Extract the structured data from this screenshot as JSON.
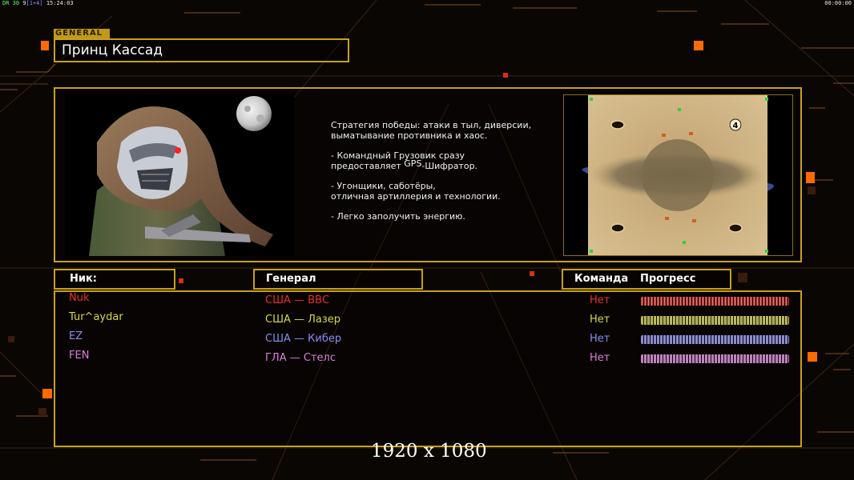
{
  "topbar": {
    "fps_label": "DR 30",
    "counter": "9",
    "bracket_text": "[1+4]",
    "clock": "15:24:03",
    "timer": "00:00:00"
  },
  "general_tag": "GENERAL",
  "general_name": "Принц Кассад",
  "description": {
    "line1": "Стратегия победы: атаки в тыл, диверсии,",
    "line2": " выматывание противника и хаос.",
    "line3": "- Командный Грузовик сразу",
    "line4_a": "предоставляет ",
    "line4_gps": "GPS",
    "line4_b": "-Шифратор.",
    "line5": "- Угонщики, саботёры,",
    "line6": "отличная артиллерия и технологии.",
    "line7": "- Легко заполучить энергию."
  },
  "minimap": {
    "player_count": "4"
  },
  "headers": {
    "nick": "Ник:",
    "general": "Генерал",
    "team": "Команда",
    "progress": "Прогресс"
  },
  "players": [
    {
      "nick": "Nuk",
      "general": "США — ВВС",
      "team": "Нет",
      "color": "#e8312b"
    },
    {
      "nick": "Tur^aydar",
      "general": "США — Лазер",
      "team": "Нет",
      "color": "#d8d840"
    },
    {
      "nick": "EZ",
      "general": "США — Кибер",
      "team": "Нет",
      "color": "#8c8cf0"
    },
    {
      "nick": "FEN",
      "general": "ГЛА — Стелс",
      "team": "Нет",
      "color": "#d880d8"
    }
  ],
  "resolution_label": "1920 x 1080",
  "colors": {
    "panel_border": "#c8a018",
    "accent_orange": "#ff6a00"
  }
}
